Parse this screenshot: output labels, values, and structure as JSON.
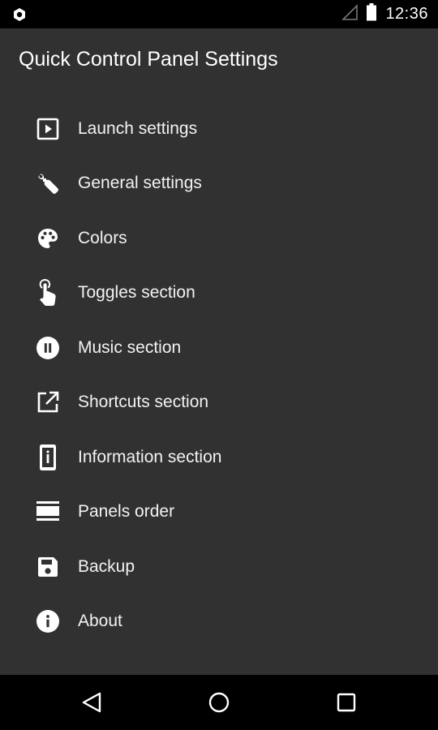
{
  "status_bar": {
    "time": "12:36",
    "left_icon": "notification-hex-icon",
    "signal_icon": "signal-icon",
    "battery_icon": "battery-icon"
  },
  "app_bar": {
    "title": "Quick Control Panel Settings"
  },
  "menu": {
    "items": [
      {
        "label": "Launch settings",
        "icon": "play-box-icon"
      },
      {
        "label": "General settings",
        "icon": "wrench-icon"
      },
      {
        "label": "Colors",
        "icon": "palette-icon"
      },
      {
        "label": "Toggles section",
        "icon": "touch-icon"
      },
      {
        "label": "Music section",
        "icon": "pause-circle-icon"
      },
      {
        "label": "Shortcuts section",
        "icon": "open-in-new-icon"
      },
      {
        "label": "Information section",
        "icon": "phone-info-icon"
      },
      {
        "label": "Panels order",
        "icon": "panels-icon"
      },
      {
        "label": "Backup",
        "icon": "save-icon"
      },
      {
        "label": "About",
        "icon": "info-icon"
      }
    ]
  },
  "nav_bar": {
    "back_icon": "back-icon",
    "home_icon": "home-icon",
    "recents_icon": "recents-icon"
  },
  "colors": {
    "background": "#313131",
    "bars": "#000000",
    "text": "#ffffff"
  }
}
